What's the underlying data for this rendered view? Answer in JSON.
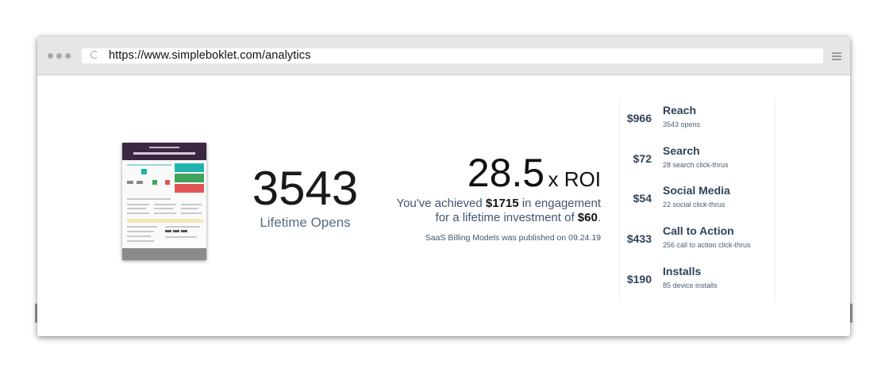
{
  "browser": {
    "url": "https://www.simpleboklet.com/analytics"
  },
  "document_thumbnail": {
    "title": "The Ultimate SaaS Billing Cheat Sheet"
  },
  "lifetime": {
    "opens": "3543",
    "label": "Lifetime Opens"
  },
  "roi": {
    "value": "28.5",
    "suffix": "x ROI",
    "line1_pre": "You've achieved ",
    "engagement": "$1715",
    "line1_post": " in engagement",
    "line2_pre": "for a lifetime investment of ",
    "investment": "$60",
    "line2_post": ".",
    "published": "SaaS Billing Models was published on 09.24.19"
  },
  "metrics": [
    {
      "amount": "$966",
      "title": "Reach",
      "subtitle": "3543 opens"
    },
    {
      "amount": "$72",
      "title": "Search",
      "subtitle": "28 search click-thrus"
    },
    {
      "amount": "$54",
      "title": "Social Media",
      "subtitle": "22 social click-thrus"
    },
    {
      "amount": "$433",
      "title": "Call to Action",
      "subtitle": "256 call to action click-thrus"
    },
    {
      "amount": "$190",
      "title": "Installs",
      "subtitle": "85 device installs"
    }
  ],
  "colors": {
    "doc_header": "#3b2740",
    "teal": "#1fb5ad",
    "green": "#3ea35b",
    "red": "#e25555",
    "label_blue": "#2f4358"
  }
}
